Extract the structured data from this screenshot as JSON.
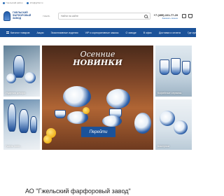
{
  "topbar": {
    "location": "Гжельский район",
    "email": "info@gzhel.ru"
  },
  "header": {
    "logo_line1": "ГЖЕЛЬСКИЙ",
    "logo_line2": "ФАРФОРОВЫЙ",
    "logo_line3": "ЗАВОД",
    "city": "ГЖЕЛЬ",
    "search_placeholder": "Найти на сайте",
    "phone": "+7 (495) 221-77-29",
    "callback": "Заказать звонок"
  },
  "nav": {
    "items": [
      "Каталог товаров",
      "Акции",
      "Эксклюзивные изделия",
      "VIP и корпоративные заказы",
      "О заводе",
      "В офис",
      "Доставка и оплата",
      "Где купить",
      "Контакты"
    ]
  },
  "tiles": {
    "left1": "Изделия декора",
    "left2": "Гжель полн...",
    "right1": "Кофейные сервизы",
    "right2": "Шкатулки"
  },
  "hero": {
    "line1": "Осенние",
    "line2": "НОВИНКИ",
    "button": "Перейти"
  },
  "company": {
    "name": "АО \"Гжельский фарфоровый завод\""
  },
  "colors": {
    "brand": "#1b5299",
    "accent": "#2d6fb8"
  }
}
